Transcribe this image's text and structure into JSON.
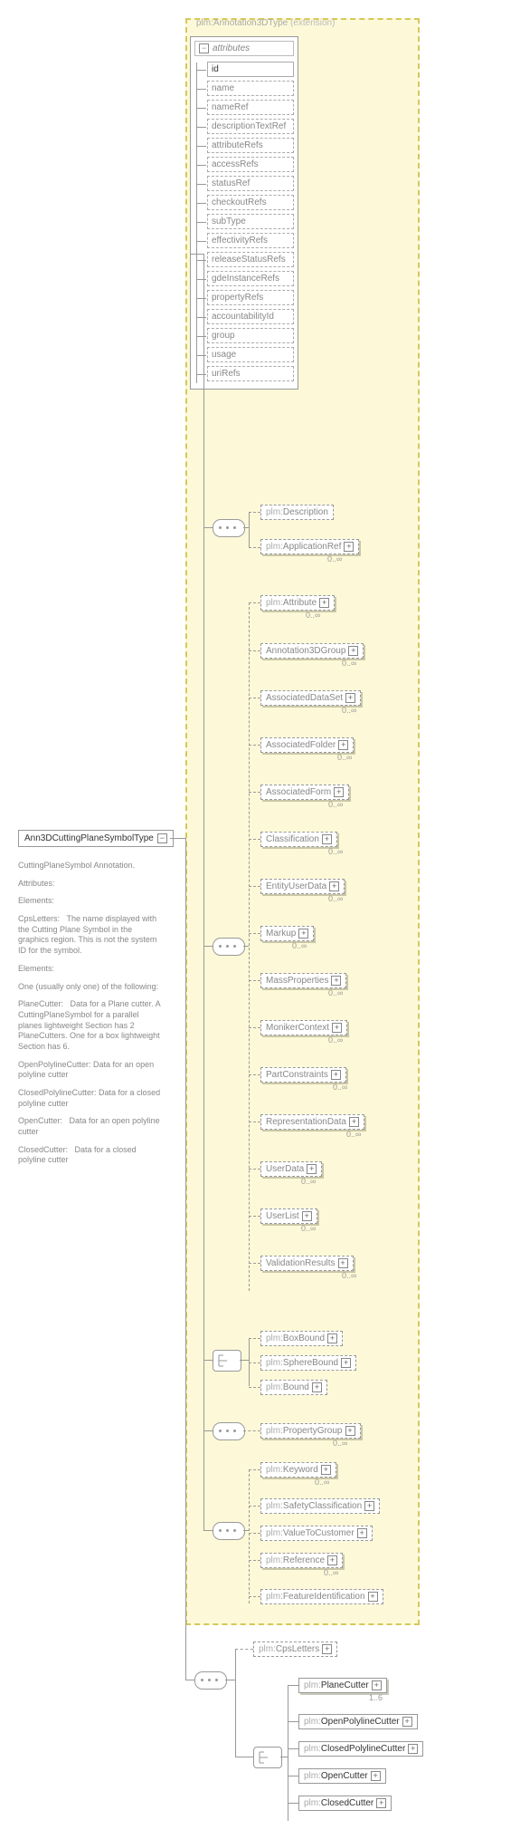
{
  "root": {
    "name": "Ann3DCuttingPlaneSymbolType"
  },
  "extension": {
    "label_prefix": "plm:",
    "label_name": "Annotation3DType",
    "label_suffix": " (extension)"
  },
  "attributes_header": "attributes",
  "attributes": [
    {
      "name": "id",
      "opt": false
    },
    {
      "name": "name",
      "opt": true
    },
    {
      "name": "nameRef",
      "opt": true
    },
    {
      "name": "descriptionTextRef",
      "opt": true
    },
    {
      "name": "attributeRefs",
      "opt": true
    },
    {
      "name": "accessRefs",
      "opt": true
    },
    {
      "name": "statusRef",
      "opt": true
    },
    {
      "name": "checkoutRefs",
      "opt": true
    },
    {
      "name": "subType",
      "opt": true
    },
    {
      "name": "effectivityRefs",
      "opt": true
    },
    {
      "name": "releaseStatusRefs",
      "opt": true
    },
    {
      "name": "gdeInstanceRefs",
      "opt": true
    },
    {
      "name": "propertyRefs",
      "opt": true
    },
    {
      "name": "accountabilityId",
      "opt": true
    },
    {
      "name": "group",
      "opt": true
    },
    {
      "name": "usage",
      "opt": true
    },
    {
      "name": "uriRefs",
      "opt": true
    }
  ],
  "groupA": [
    {
      "name": "Description",
      "pfx": "plm:",
      "opt": true,
      "card": ""
    },
    {
      "name": "ApplicationRef",
      "pfx": "plm:",
      "opt": true,
      "card": "0..∞",
      "exp": true
    }
  ],
  "attribute_elem": {
    "name": "Attribute",
    "pfx": "plm:",
    "opt": true,
    "card": "0..∞",
    "exp": true
  },
  "groupB": [
    {
      "name": "Annotation3DGroup",
      "opt": true,
      "card": "0..∞",
      "exp": true
    },
    {
      "name": "AssociatedDataSet",
      "opt": true,
      "card": "0..∞",
      "exp": true
    },
    {
      "name": "AssociatedFolder",
      "opt": true,
      "card": "0..∞",
      "exp": true
    },
    {
      "name": "AssociatedForm",
      "opt": true,
      "card": "0..∞",
      "exp": true
    },
    {
      "name": "Classification",
      "opt": true,
      "card": "0..∞",
      "exp": true
    },
    {
      "name": "EntityUserData",
      "opt": true,
      "card": "0..∞",
      "exp": true
    },
    {
      "name": "Markup",
      "opt": true,
      "card": "0..∞",
      "exp": true
    },
    {
      "name": "MassProperties",
      "opt": true,
      "card": "0..∞",
      "exp": true
    },
    {
      "name": "MonikerContext",
      "opt": true,
      "card": "0..∞",
      "exp": true
    },
    {
      "name": "PartConstraints",
      "opt": true,
      "card": "0..∞",
      "exp": true
    },
    {
      "name": "RepresentationData",
      "opt": true,
      "card": "0..∞",
      "exp": true
    },
    {
      "name": "UserData",
      "opt": true,
      "card": "0..∞",
      "exp": true
    },
    {
      "name": "UserList",
      "opt": true,
      "card": "0..∞",
      "exp": true
    },
    {
      "name": "ValidationResults",
      "opt": true,
      "card": "0..∞",
      "exp": true
    }
  ],
  "groupC": [
    {
      "name": "BoxBound",
      "pfx": "plm:",
      "opt": true,
      "exp": true
    },
    {
      "name": "SphereBound",
      "pfx": "plm:",
      "opt": true,
      "exp": true
    },
    {
      "name": "Bound",
      "pfx": "plm:",
      "opt": true,
      "exp": true
    }
  ],
  "propertyGroup": {
    "name": "PropertyGroup",
    "pfx": "plm:",
    "opt": true,
    "card": "0..∞",
    "exp": true
  },
  "groupD": [
    {
      "name": "Keyword",
      "pfx": "plm:",
      "opt": true,
      "card": "0..∞",
      "exp": true
    },
    {
      "name": "SafetyClassification",
      "pfx": "plm:",
      "opt": true,
      "exp": true
    },
    {
      "name": "ValueToCustomer",
      "pfx": "plm:",
      "opt": true,
      "exp": true
    },
    {
      "name": "Reference",
      "pfx": "plm:",
      "opt": true,
      "card": "0..∞",
      "exp": true
    },
    {
      "name": "FeatureIdentification",
      "pfx": "plm:",
      "opt": true,
      "exp": true
    }
  ],
  "cpsLetters": {
    "name": "CpsLetters",
    "pfx": "plm:",
    "opt": true,
    "exp": true
  },
  "cutters": [
    {
      "name": "PlaneCutter",
      "pfx": "plm:",
      "opt": false,
      "card": "1..6",
      "exp": true
    },
    {
      "name": "OpenPolylineCutter",
      "pfx": "plm:",
      "opt": false,
      "exp": true
    },
    {
      "name": "ClosedPolylineCutter",
      "pfx": "plm:",
      "opt": false,
      "exp": true
    },
    {
      "name": "OpenCutter",
      "pfx": "plm:",
      "opt": false,
      "exp": true
    },
    {
      "name": "ClosedCutter",
      "pfx": "plm:",
      "opt": false,
      "exp": true
    }
  ],
  "description": {
    "title": "CuttingPlaneSymbol Annotation.",
    "p1": "Attributes:",
    "p2": "Elements:",
    "p3_label": "CpsLetters:",
    "p3_text": "The name displayed with the Cutting Plane Symbol in the graphics region. This is not the system ID for the symbol.",
    "p4": "Elements:",
    "p5": "One (usually only one) of the following:",
    "p6_label": "PlaneCutter:",
    "p6_text": "Data for a Plane cutter. A CuttingPlaneSymbol for a parallel planes lightweight Section has 2 PlaneCutters. One for a box lightweight Section has 6.",
    "p7": "OpenPolylineCutter: Data for an open polyline cutter",
    "p8": "ClosedPolylineCutter: Data for a closed polyline cutter",
    "p9_label": "OpenCutter:",
    "p9_text": "Data for an open polyline cutter",
    "p10_label": "ClosedCutter:",
    "p10_text": "Data for a closed polyline cutter"
  }
}
